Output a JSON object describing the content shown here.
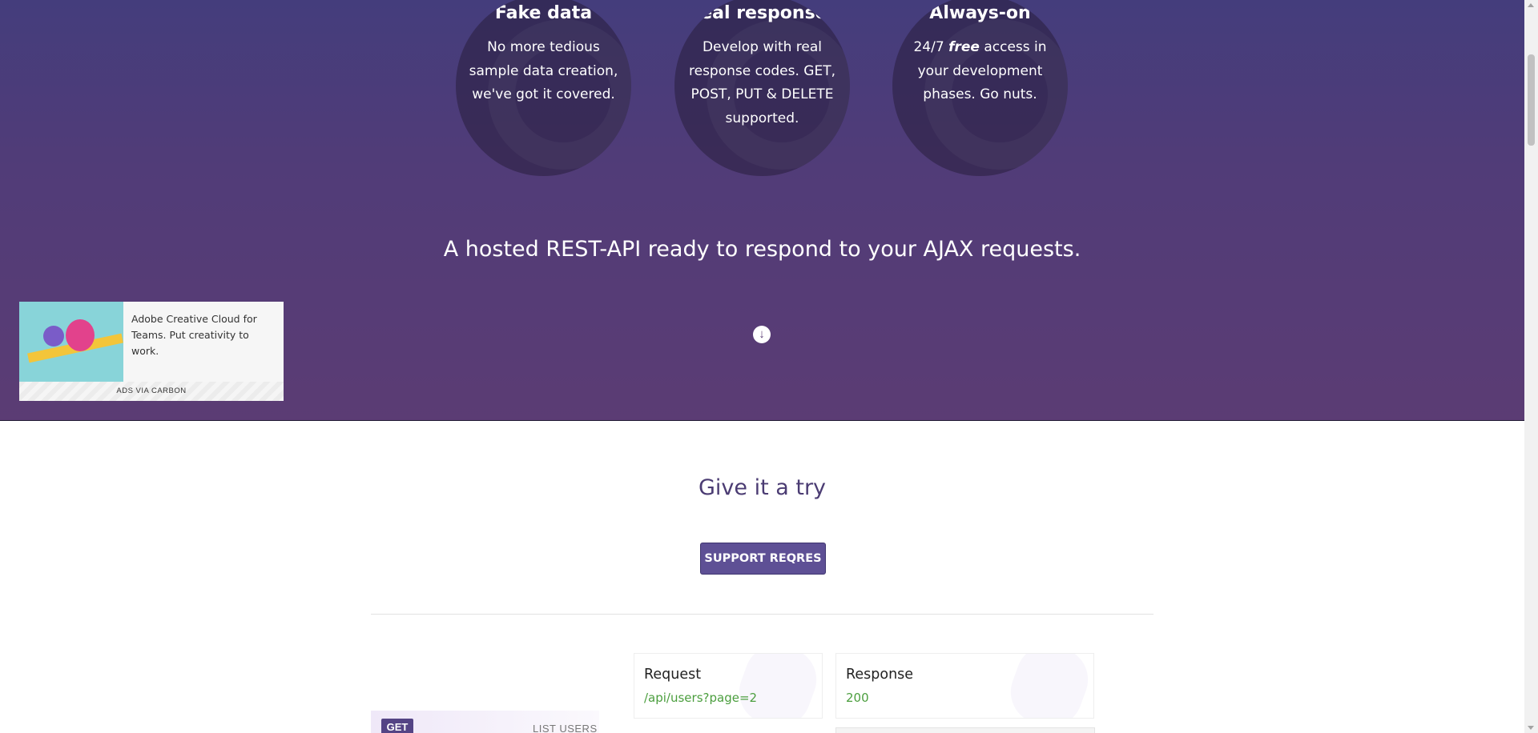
{
  "features": [
    {
      "title": "Fake data",
      "text": "No more tedious sample data creation, we've got it covered."
    },
    {
      "title": "Real responses",
      "text": "Develop with real response codes. GET, POST, PUT & DELETE supported."
    },
    {
      "title": "Always-on",
      "text_pre": "24/7",
      "text_em": "free",
      "text_post": "access in your development phases. Go nuts."
    }
  ],
  "hero": {
    "tagline": "A hosted REST-API ready to respond to your AJAX requests.",
    "down_icon": "arrow-down-circle-icon"
  },
  "ad": {
    "text": "Adobe Creative Cloud for Teams. Put creativity to work.",
    "footer": "ADS VIA CARBON"
  },
  "try": {
    "title": "Give it a try",
    "support_button": "SUPPORT REQRES"
  },
  "endpoint": {
    "method": "GET",
    "name": "LIST USERS"
  },
  "request": {
    "label": "Request",
    "value": "/api/users?page=2"
  },
  "response": {
    "label": "Response",
    "value": "200"
  },
  "colors": {
    "hero_top": "#443d7c",
    "hero_bottom": "#5b3c74",
    "accent": "#5e5095",
    "success": "#4b9e3e"
  }
}
